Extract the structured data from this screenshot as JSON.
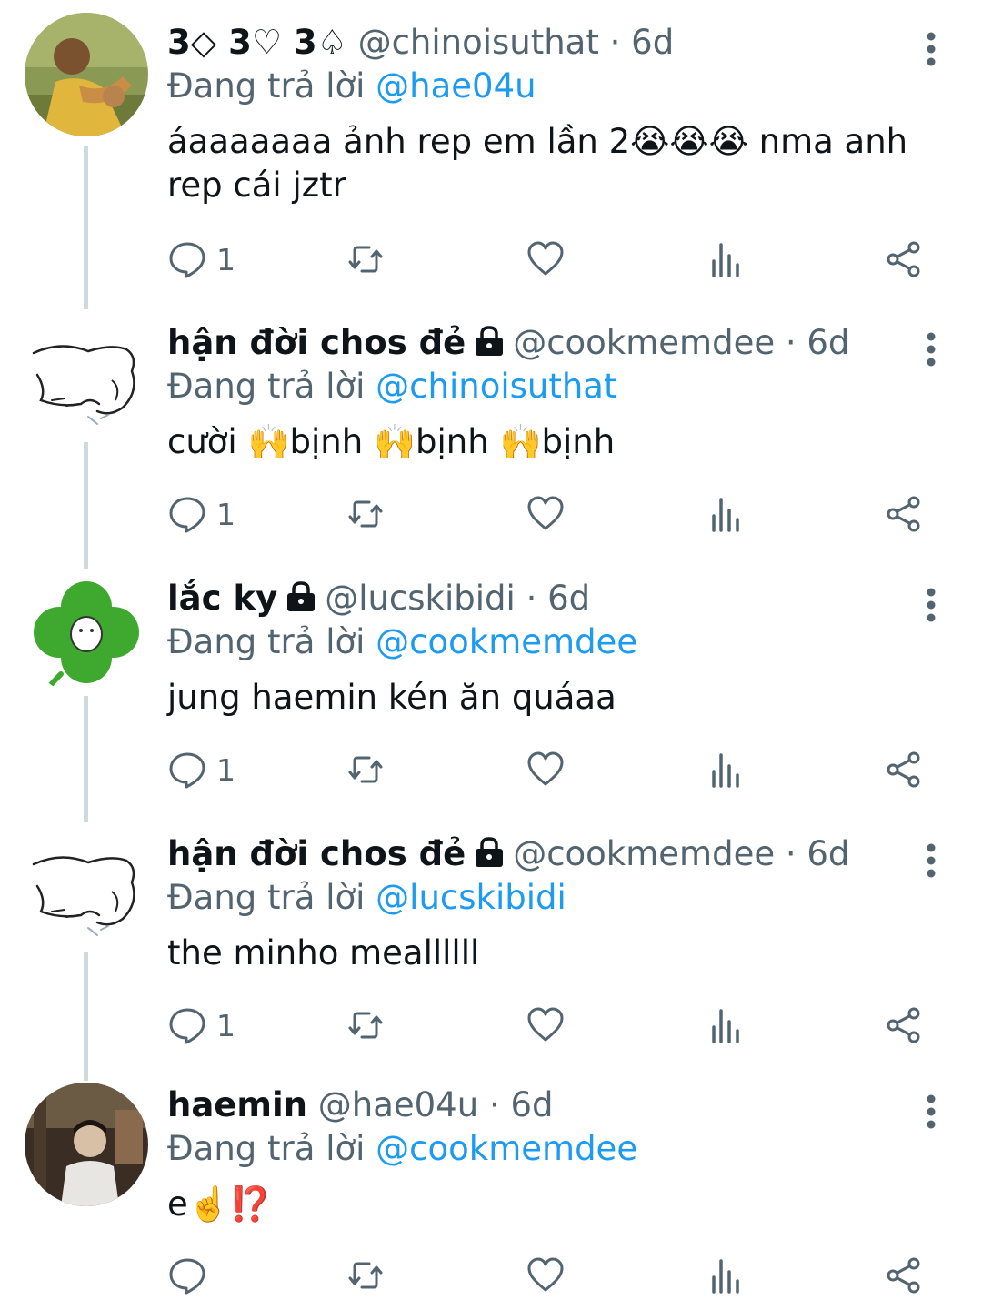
{
  "colors": {
    "link": "#1d9bf0",
    "secondary_text": "#536471",
    "primary_text": "#0f1419",
    "thread_line": "#cfd9de"
  },
  "icons": {
    "reply": "speech-bubble-icon",
    "retweet": "retweet-arrows-icon",
    "like": "heart-icon",
    "views": "bar-chart-icon",
    "share": "share-nodes-icon",
    "more": "vertical-dots-icon",
    "protected": "lock-icon"
  },
  "tweets": [
    {
      "display_name": "3◇ 3♡ 3♤",
      "protected": false,
      "handle": "@chinoisuthat",
      "dot": "·",
      "time": "6d",
      "reply_prefix": "Đang trả lời",
      "reply_to": "@hae04u",
      "text": "áaaaaaaa ảnh rep em lần 2😭😭😭 nma anh rep cái jztr",
      "reply_count": "1",
      "avatar": "photo-person-avatar"
    },
    {
      "display_name": "hận đời chos đẻ",
      "protected": true,
      "handle": "@cookmemdee",
      "dot": "·",
      "time": "6d",
      "reply_prefix": "Đang trả lời",
      "reply_to": "@chinoisuthat",
      "text": "cười 🙌bịnh 🙌bịnh 🙌bịnh",
      "reply_count": "1",
      "avatar": "sketch-dog-avatar"
    },
    {
      "display_name": "lắc ky",
      "protected": true,
      "handle": "@lucskibidi",
      "dot": "·",
      "time": "6d",
      "reply_prefix": "Đang trả lời",
      "reply_to": "@cookmemdee",
      "text": "jung haemin kén ăn quáaa",
      "reply_count": "1",
      "avatar": "four-leaf-clover-avatar"
    },
    {
      "display_name": "hận đời chos đẻ",
      "protected": true,
      "handle": "@cookmemdee",
      "dot": "·",
      "time": "6d",
      "reply_prefix": "Đang trả lời",
      "reply_to": "@lucskibidi",
      "text": "the minho meallllll",
      "reply_count": "1",
      "avatar": "sketch-dog-avatar"
    },
    {
      "display_name": "haemin",
      "protected": false,
      "handle": "@hae04u",
      "dot": "·",
      "time": "6d",
      "reply_prefix": "Đang trả lời",
      "reply_to": "@cookmemdee",
      "text": "e☝️⁉️",
      "reply_count": "",
      "avatar": "photo-person-avatar"
    }
  ]
}
